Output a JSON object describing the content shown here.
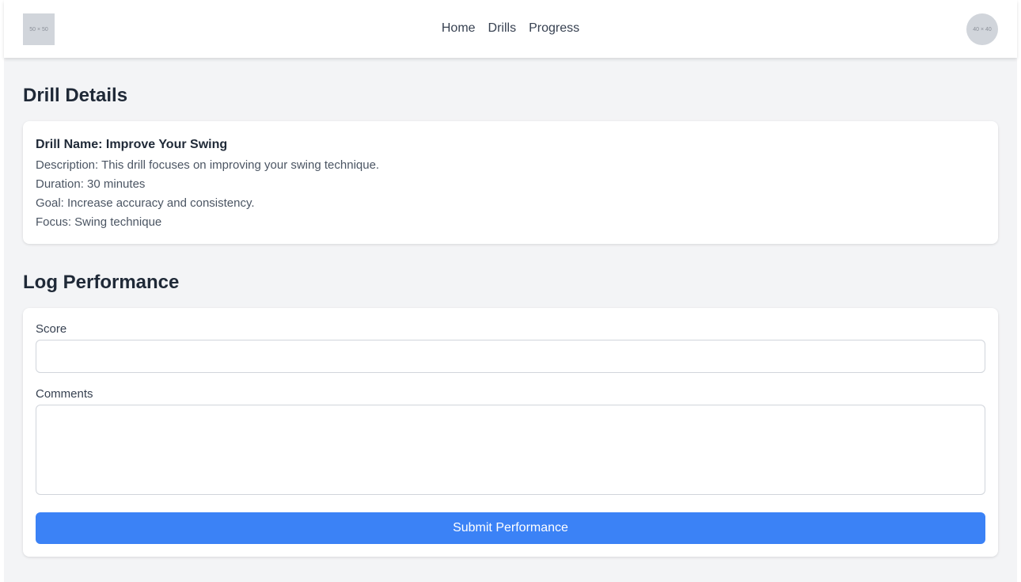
{
  "header": {
    "logo_placeholder": "50 × 50",
    "avatar_placeholder": "40 × 40",
    "nav": [
      {
        "label": "Home"
      },
      {
        "label": "Drills"
      },
      {
        "label": "Progress"
      }
    ]
  },
  "drill_details": {
    "heading": "Drill Details",
    "name": "Drill Name: Improve Your Swing",
    "description": "Description: This drill focuses on improving your swing technique.",
    "duration": "Duration: 30 minutes",
    "goal": "Goal: Increase accuracy and consistency.",
    "focus": "Focus: Swing technique"
  },
  "log_performance": {
    "heading": "Log Performance",
    "score_label": "Score",
    "score_value": "",
    "comments_label": "Comments",
    "comments_value": "",
    "submit_label": "Submit Performance"
  },
  "colors": {
    "background": "#f3f4f6",
    "primary_button": "#3b82f6",
    "heading_text": "#1f2937"
  }
}
